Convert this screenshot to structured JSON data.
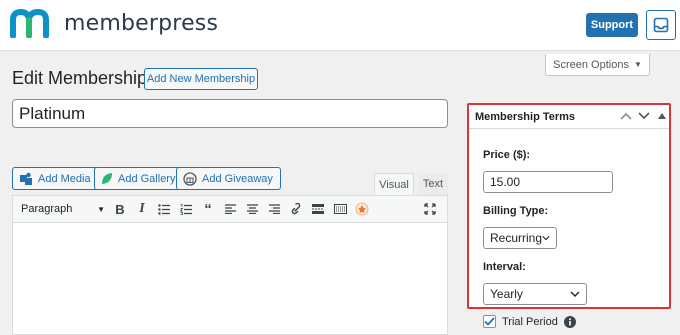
{
  "brand": {
    "name": "memberpress",
    "logo_icon": "memberpress-m-logo",
    "accent": "#0e91cb",
    "dark": "#2a3b4d"
  },
  "header": {
    "support_label": "Support",
    "inbox_icon": "inbox-icon"
  },
  "screen_options": {
    "label": "Screen Options",
    "caret": "▼"
  },
  "page": {
    "title": "Edit Membership",
    "add_new_label": "Add New Membership"
  },
  "post_title": {
    "value": "Platinum"
  },
  "media_buttons": [
    {
      "label": "Add Media",
      "icon": "media-icon"
    },
    {
      "label": "Add Gallery",
      "icon": "leaf-icon"
    },
    {
      "label": "Add Giveaway",
      "icon": "giveaway-icon"
    }
  ],
  "editor": {
    "tabs": {
      "visual": "Visual",
      "text": "Text"
    },
    "format_select": "Paragraph"
  },
  "terms": {
    "title": "Membership Terms",
    "price_label": "Price ($):",
    "price_value": "15.00",
    "billing_label": "Billing Type:",
    "billing_value": "Recurring",
    "interval_label": "Interval:",
    "interval_value": "Yearly"
  },
  "trial": {
    "label": "Trial Period",
    "checked": true
  },
  "colors": {
    "primary": "#2271b1",
    "highlight": "#d63638"
  }
}
